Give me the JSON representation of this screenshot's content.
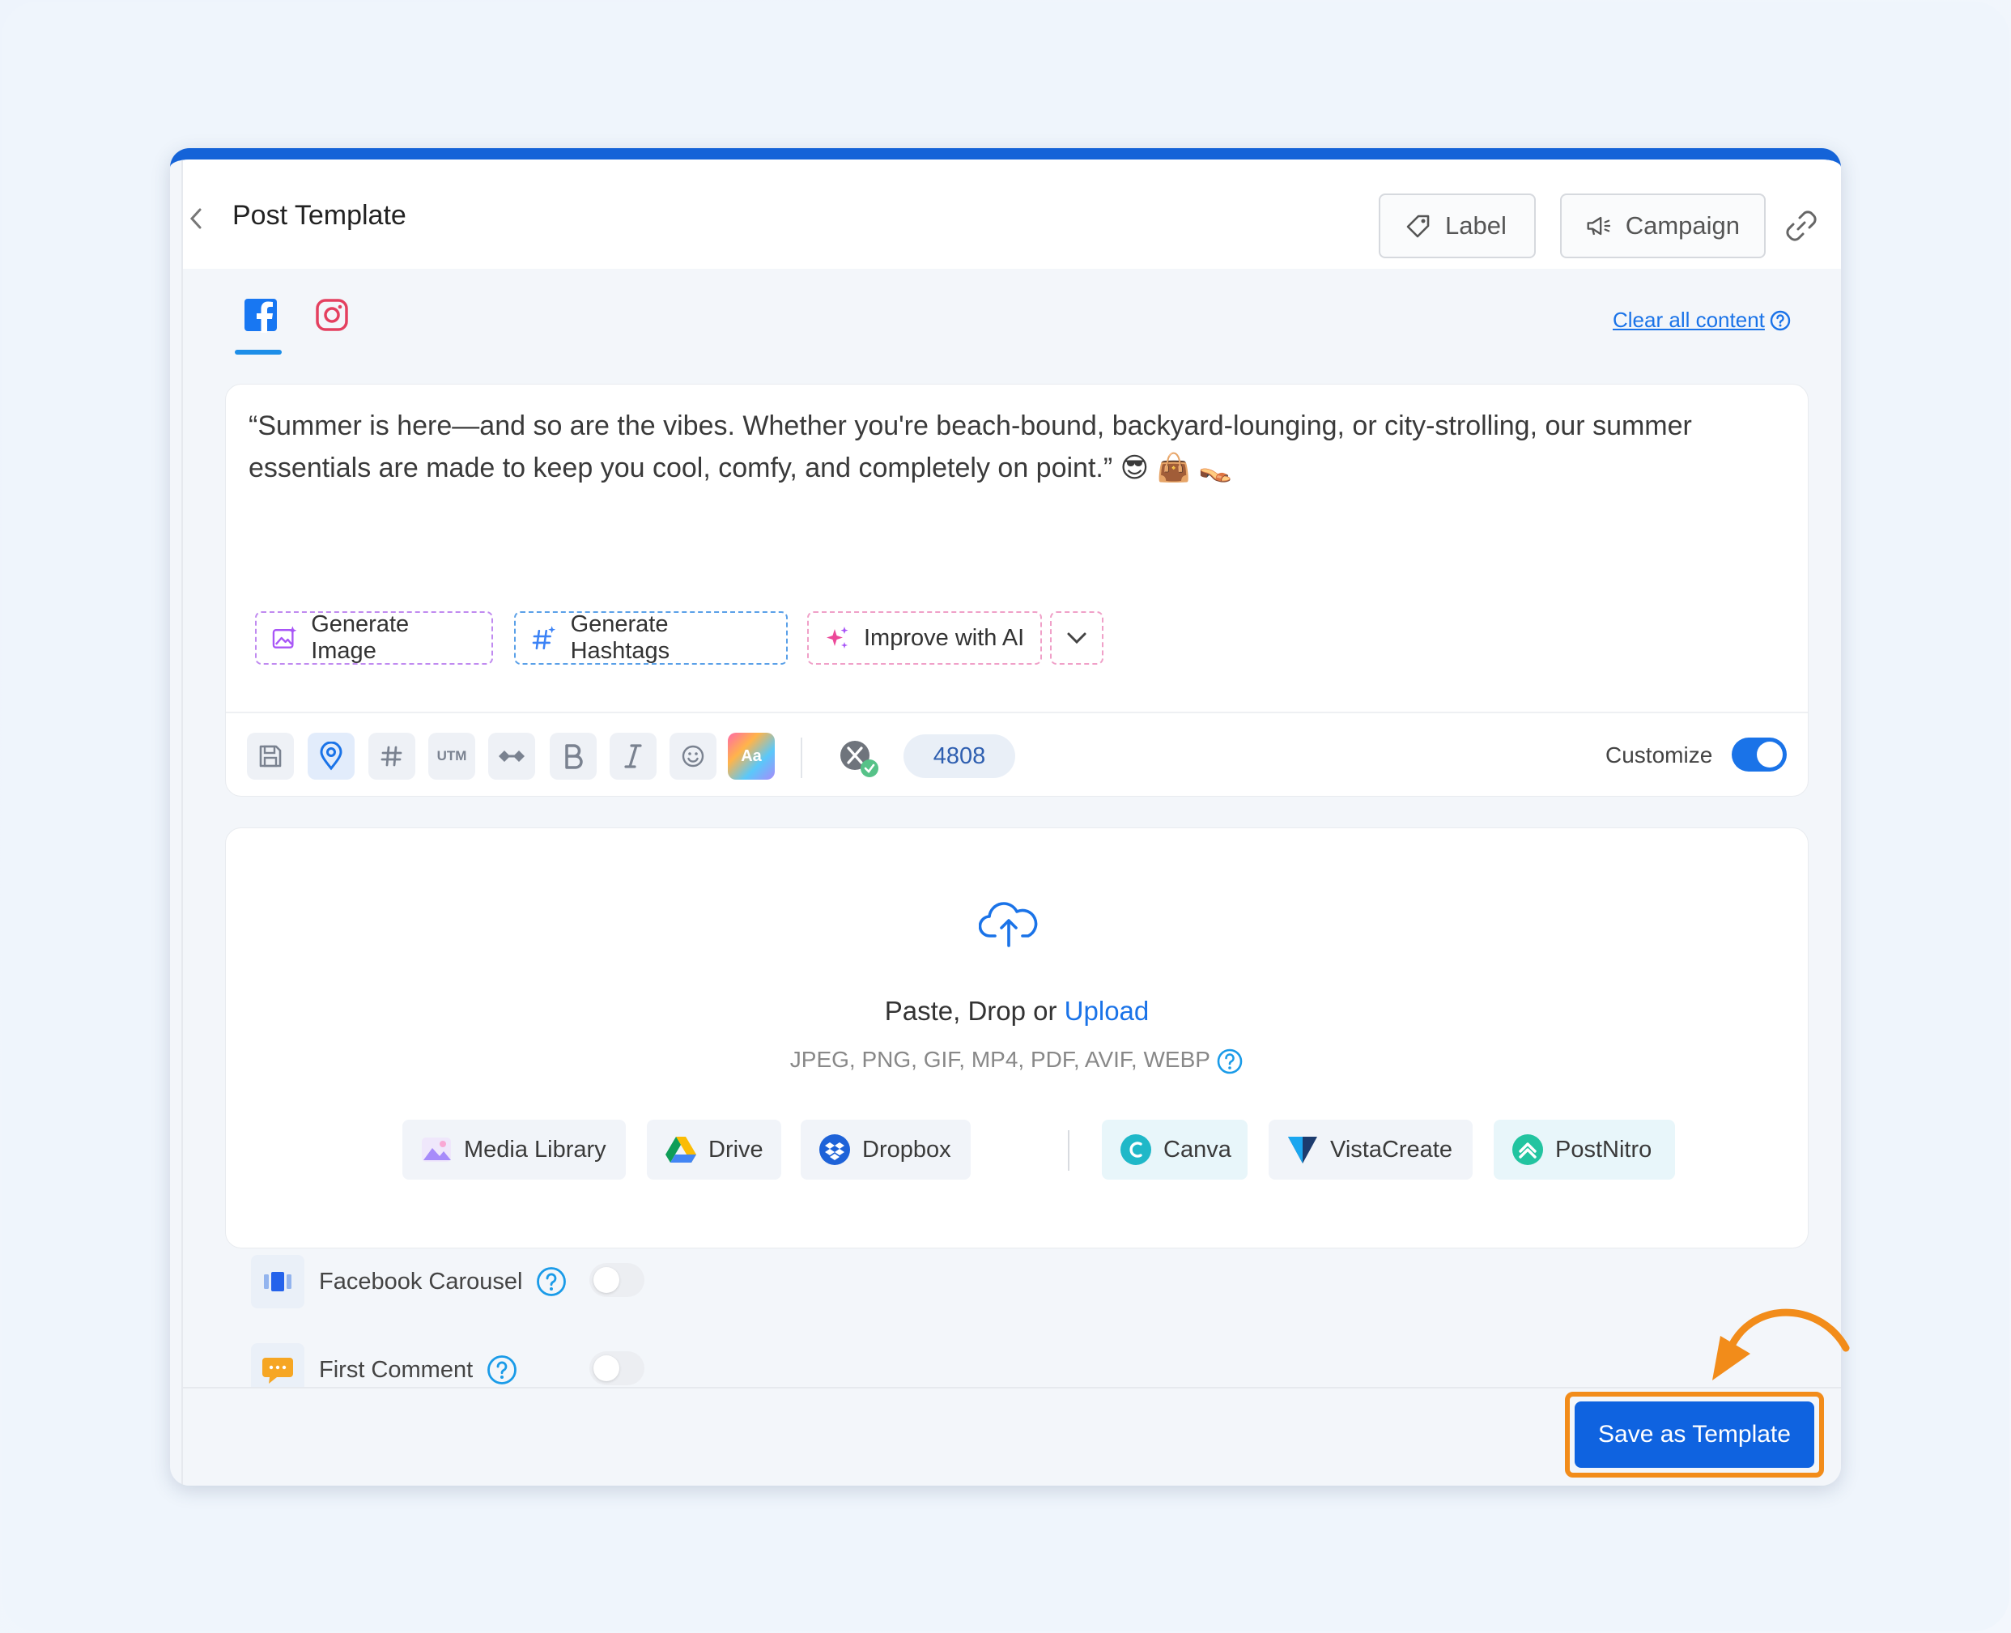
{
  "modal": {
    "title": "Post Template",
    "label_button": "Label",
    "campaign_button": "Campaign",
    "clear_all": "Clear all content"
  },
  "editor": {
    "text": "“Summer is here—and so are the vibes. Whether you're beach-bound, backyard-lounging, or city-strolling, our summer essentials are made to keep you cool, comfy, and completely on point.” 😎 👜 👡",
    "ai_buttons": {
      "generate_image": "Generate Image",
      "generate_hashtags": "Generate Hashtags",
      "improve_ai": "Improve with AI"
    },
    "toolbar": {
      "utm": "UTM",
      "aa": "Aa",
      "char_count": "4808",
      "customize": "Customize"
    }
  },
  "upload": {
    "title_prefix": "Paste, Drop or ",
    "title_link": "Upload",
    "formats": "JPEG, PNG, GIF, MP4, PDF, AVIF, WEBP",
    "sources": {
      "media_library": "Media Library",
      "drive": "Drive",
      "dropbox": "Dropbox",
      "canva": "Canva",
      "vistacreate": "VistaCreate",
      "postnitro": "PostNitro"
    }
  },
  "options": {
    "facebook_carousel": "Facebook Carousel",
    "first_comment": "First Comment"
  },
  "footer": {
    "save_template": "Save as Template"
  },
  "colors": {
    "accent": "#1a73e8",
    "highlight": "#f28c1a",
    "header_bar": "#1463d8"
  }
}
